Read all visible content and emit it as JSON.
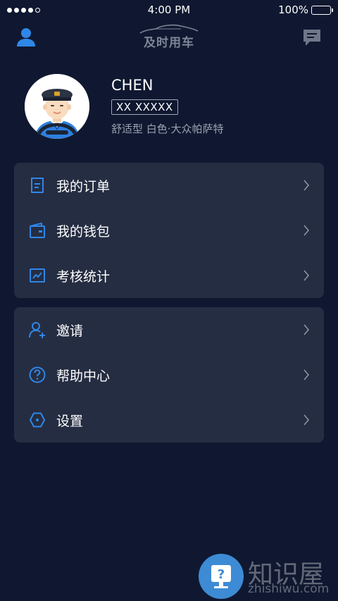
{
  "status_bar": {
    "time": "4:00 PM",
    "battery": "100%"
  },
  "header": {
    "logo_text": "及时用车"
  },
  "profile": {
    "name": "CHEN",
    "plate": "XX XXXXX",
    "car_info": "舒适型 白色·大众帕萨特"
  },
  "menu_primary": [
    {
      "label": "我的订单",
      "icon": "order-icon"
    },
    {
      "label": "我的钱包",
      "icon": "wallet-icon"
    },
    {
      "label": "考核统计",
      "icon": "stats-icon"
    }
  ],
  "menu_secondary": [
    {
      "label": "邀请",
      "icon": "invite-icon"
    },
    {
      "label": "帮助中心",
      "icon": "help-icon"
    },
    {
      "label": "设置",
      "icon": "settings-icon"
    }
  ],
  "watermark": {
    "title": "知识屋",
    "url": "zhishiwu.com"
  },
  "colors": {
    "background": "#0f1830",
    "card": "#252d42",
    "accent": "#2f87e8"
  }
}
